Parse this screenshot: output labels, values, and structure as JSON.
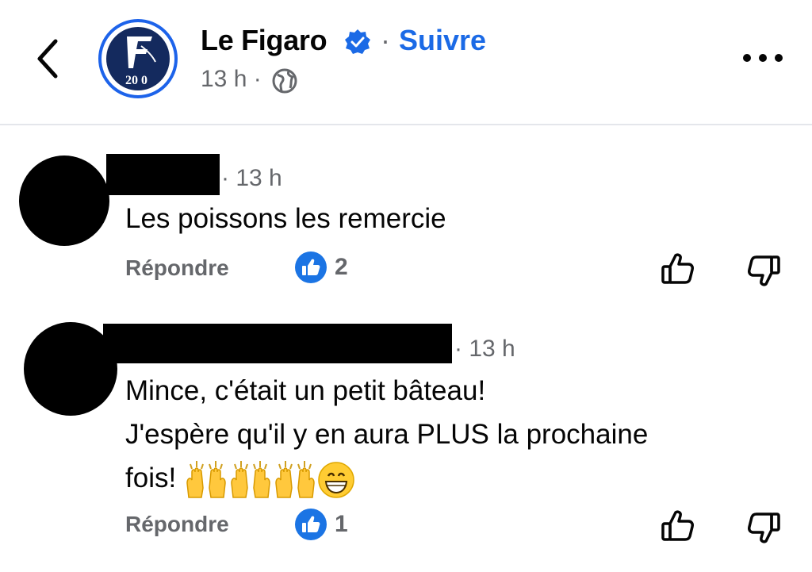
{
  "header": {
    "page_name": "Le Figaro",
    "separator": "·",
    "follow_label": "Suivre",
    "post_time": "13 h ·",
    "logo_text": "20",
    "verified_color": "#1b6ae6"
  },
  "comments": [
    {
      "author": "",
      "time": "· 13 h",
      "text_lines": [
        "Les poissons les remercie"
      ],
      "reply_label": "Répondre",
      "like_count": "2"
    },
    {
      "author": "",
      "time": "· 13 h",
      "text_lines": [
        "Mince, c'était un petit bâteau!",
        "J'espère qu'il y en aura PLUS la prochaine",
        "fois!"
      ],
      "emojis": [
        "raising-hands-emoji",
        "raising-hands-emoji",
        "raising-hands-emoji",
        "grinning-face-emoji"
      ],
      "reply_label": "Répondre",
      "like_count": "1"
    }
  ]
}
